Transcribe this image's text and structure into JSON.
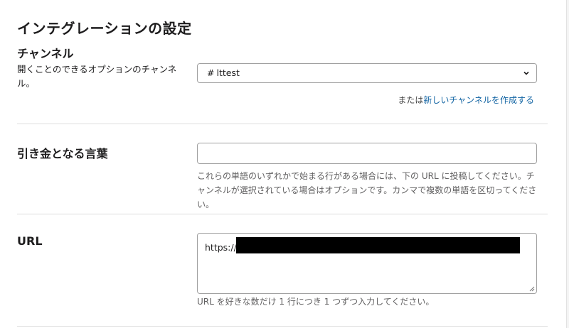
{
  "page": {
    "title": "インテグレーションの設定"
  },
  "channel": {
    "label": "チャンネル",
    "description": "開くことのできるオプションのチャンネル。",
    "selected_prefix": "#",
    "selected_value": "lttest",
    "create_prefix": "または",
    "create_link": "新しいチャンネルを作成する"
  },
  "trigger": {
    "label": "引き金となる言葉",
    "value": "",
    "help": "これらの単語のいずれかで始まる行がある場合には、下の URL に投稿してください。チャンネルが選択されている場合はオプションです。カンマで複数の単語を区切ってください。"
  },
  "url": {
    "label": "URL",
    "prefix": "https://",
    "help": "URL を好きな数だけ 1 行につき 1 つずつ入力してください。"
  },
  "icons": {
    "select_chevron": "chevron-down-icon",
    "textarea_resize": "resize-handle-icon"
  }
}
